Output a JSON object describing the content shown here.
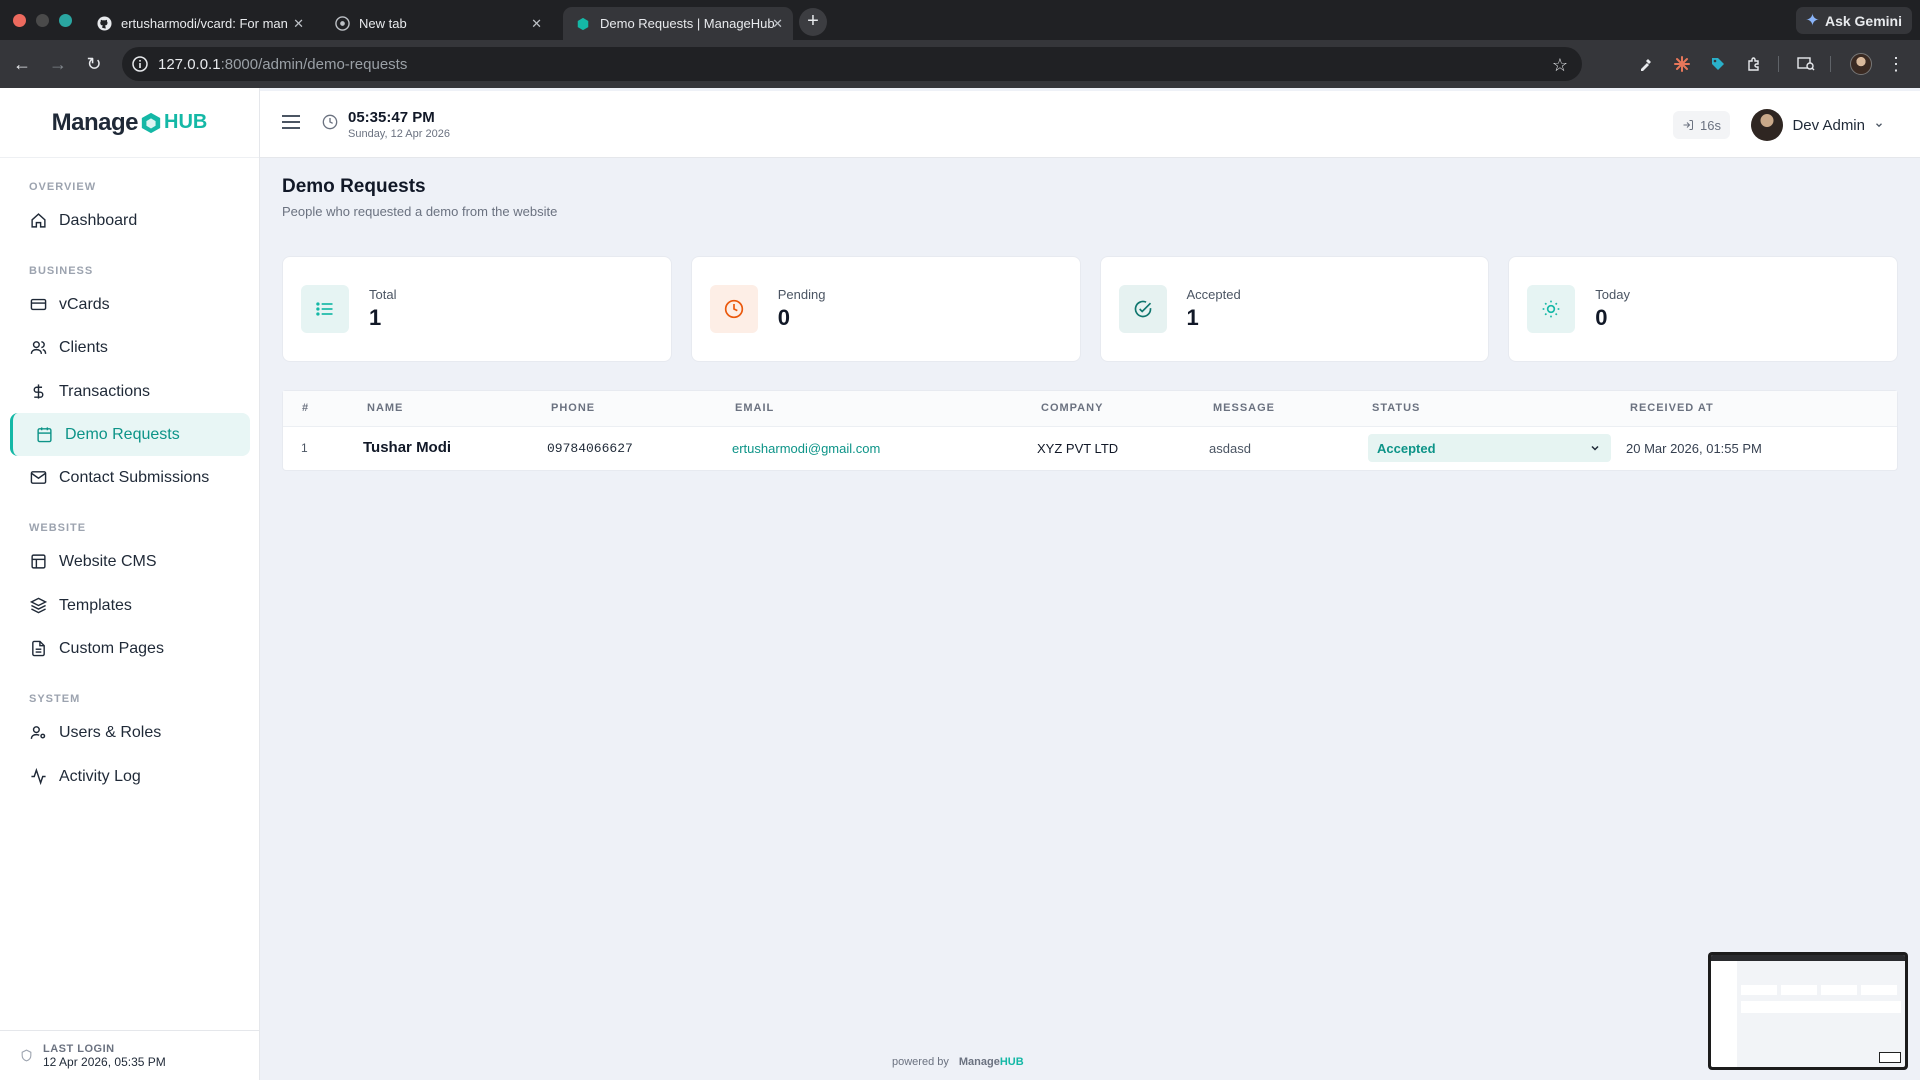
{
  "browser": {
    "tabs": [
      {
        "title": "ertusharmodi/vcard: For man",
        "icon": "github-icon",
        "active": false
      },
      {
        "title": "New tab",
        "icon": "chrome-icon",
        "active": false
      },
      {
        "title": "Demo Requests | ManageHub",
        "icon": "managehub-icon",
        "active": true
      }
    ],
    "new_tab_label": "+",
    "ask_gemini": "Ask Gemini",
    "url_host": "127.0.0.1",
    "url_path": ":8000/admin/demo-requests"
  },
  "brand": {
    "name": "Manage",
    "suffix": "HUB"
  },
  "sidebar": {
    "sections": [
      {
        "title": "OVERVIEW",
        "items": [
          {
            "label": "Dashboard",
            "icon": "home-icon"
          }
        ]
      },
      {
        "title": "BUSINESS",
        "items": [
          {
            "label": "vCards",
            "icon": "card-icon"
          },
          {
            "label": "Clients",
            "icon": "users-icon"
          },
          {
            "label": "Transactions",
            "icon": "dollar-icon"
          },
          {
            "label": "Demo Requests",
            "icon": "calendar-icon",
            "active": true
          },
          {
            "label": "Contact Submissions",
            "icon": "mail-icon"
          }
        ]
      },
      {
        "title": "WEBSITE",
        "items": [
          {
            "label": "Website CMS",
            "icon": "layout-icon"
          },
          {
            "label": "Templates",
            "icon": "layers-icon"
          },
          {
            "label": "Custom Pages",
            "icon": "file-icon"
          }
        ]
      },
      {
        "title": "SYSTEM",
        "items": [
          {
            "label": "Users & Roles",
            "icon": "user-cog-icon"
          },
          {
            "label": "Activity Log",
            "icon": "activity-icon"
          }
        ]
      }
    ],
    "last_login_label": "LAST LOGIN",
    "last_login_value": "12 Apr 2026, 05:35 PM"
  },
  "topbar": {
    "time": "05:35:47 PM",
    "date": "Sunday, 12 Apr 2026",
    "session": "16s",
    "user_name": "Dev Admin"
  },
  "page": {
    "title": "Demo Requests",
    "subtitle": "People who requested a demo from the website"
  },
  "stats": [
    {
      "label": "Total",
      "value": "1",
      "icon": "list-icon",
      "color": "#14b8a6",
      "bg": "#e6f4f3"
    },
    {
      "label": "Pending",
      "value": "0",
      "icon": "clock-icon",
      "color": "#ea580c",
      "bg": "#fdeee6"
    },
    {
      "label": "Accepted",
      "value": "1",
      "icon": "check-circle-icon",
      "color": "#0f766e",
      "bg": "#e6f2f1"
    },
    {
      "label": "Today",
      "value": "0",
      "icon": "sun-icon",
      "color": "#14b8a6",
      "bg": "#e6f4f3"
    }
  ],
  "table": {
    "headers": [
      "#",
      "NAME",
      "PHONE",
      "EMAIL",
      "COMPANY",
      "MESSAGE",
      "STATUS",
      "RECEIVED AT"
    ],
    "rows": [
      {
        "num": "1",
        "name": "Tushar Modi",
        "phone": "09784066627",
        "email": "ertusharmodi@gmail.com",
        "company": "XYZ PVT LTD",
        "message": "asdasd",
        "status": "Accepted",
        "received": "20 Mar 2026, 01:55 PM"
      }
    ]
  },
  "footer": {
    "powered_by": "powered by",
    "brand": "Manage",
    "brand_suffix": "HUB"
  },
  "colors": {
    "accent": "#14b8a6",
    "accent_dark": "#0d9488",
    "background": "#eef1f7"
  }
}
